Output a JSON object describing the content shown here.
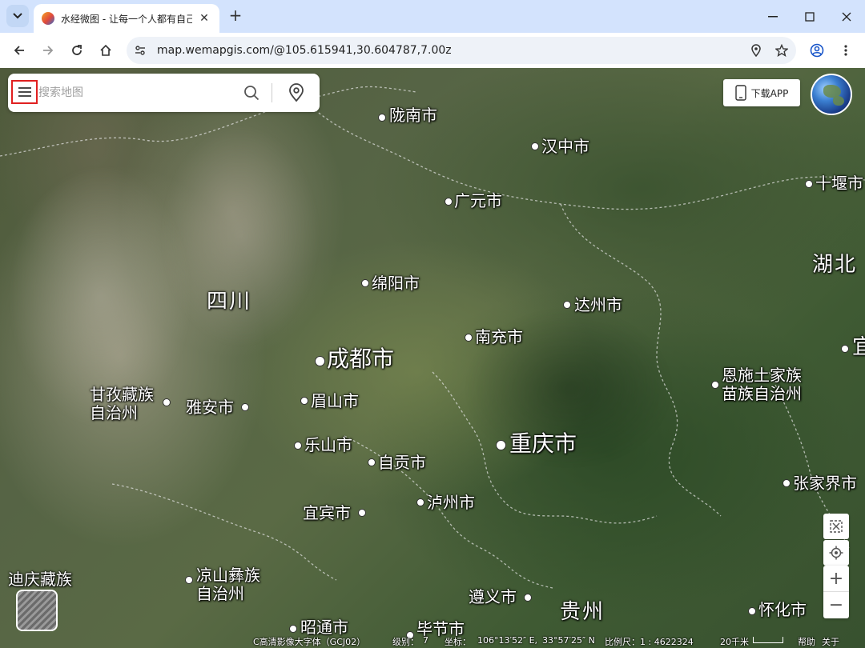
{
  "browser": {
    "tab_title": "水经微图 - 让每一个人都有自己",
    "url": "map.wemapgis.com/@105.615941,30.604787,7.00z"
  },
  "search": {
    "placeholder": "搜索地图"
  },
  "download_button": "下载APP",
  "map": {
    "places": [
      {
        "name": "陇南市",
        "size": "normal"
      },
      {
        "name": "汉中市",
        "size": "normal"
      },
      {
        "name": "十堰市",
        "size": "normal"
      },
      {
        "name": "广元市",
        "size": "normal"
      },
      {
        "name": "湖北",
        "size": "province"
      },
      {
        "name": "绵阳市",
        "size": "normal"
      },
      {
        "name": "四川",
        "size": "province"
      },
      {
        "name": "达州市",
        "size": "normal"
      },
      {
        "name": "南充市",
        "size": "normal"
      },
      {
        "name": "宜",
        "size": "province"
      },
      {
        "name": "成都市",
        "size": "large"
      },
      {
        "name": "恩施土家族\n苗族自治州",
        "size": "normal"
      },
      {
        "name": "甘孜藏族\n自治州",
        "size": "normal"
      },
      {
        "name": "雅安市",
        "size": "normal"
      },
      {
        "name": "眉山市",
        "size": "normal"
      },
      {
        "name": "乐山市",
        "size": "normal"
      },
      {
        "name": "重庆市",
        "size": "large"
      },
      {
        "name": "自贡市",
        "size": "normal"
      },
      {
        "name": "张家界市",
        "size": "normal"
      },
      {
        "name": "宜宾市",
        "size": "normal"
      },
      {
        "name": "泸州市",
        "size": "normal"
      },
      {
        "name": "迪庆藏族",
        "size": "normal"
      },
      {
        "name": "凉山彝族\n自治州",
        "size": "normal"
      },
      {
        "name": "遵义市",
        "size": "normal"
      },
      {
        "name": "贵州",
        "size": "province"
      },
      {
        "name": "怀化市",
        "size": "normal"
      },
      {
        "name": "昭通市",
        "size": "normal"
      },
      {
        "name": "毕节市",
        "size": "normal"
      }
    ]
  },
  "status": {
    "source": "C高清影像大字体（GCJ02）",
    "level_label": "级别：",
    "level_value": "7",
    "coord_label": "坐标：",
    "lon": "106°13′52″ E,",
    "lat": "33°57′25″ N",
    "scale_label": "比例尺：1 : 4622324",
    "scale_bar": "20千米",
    "help": "帮助",
    "close": "关于"
  },
  "colors": {
    "accent_border": "#e02020",
    "tabbar_bg": "#d3e3fd"
  }
}
